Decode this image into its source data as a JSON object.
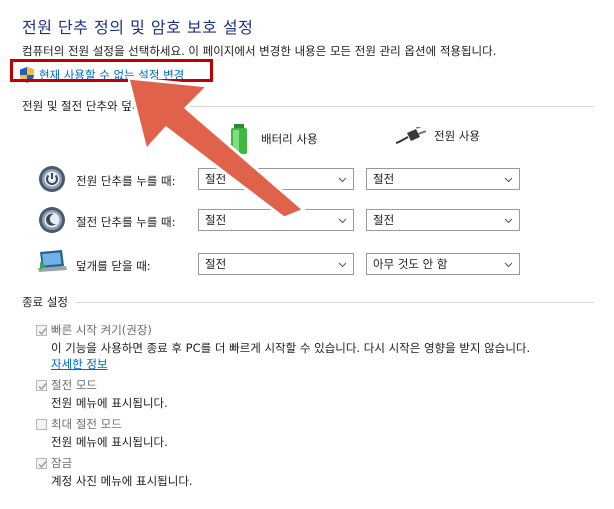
{
  "page": {
    "title": "전원 단추 정의 및 암호 보호 설정",
    "description": "컴퓨터의 전원 설정을 선택하세요. 이 페이지에서 변경한 내용은 모든 전원 관리 옵션에 적용됩니다.",
    "change_link": "현재 사용할 수 없는 설정 변경"
  },
  "power_section": {
    "heading": "전원 및 절전 단추와 덮개 설정",
    "columns": [
      {
        "label": "배터리 사용",
        "icon": "battery-icon"
      },
      {
        "label": "전원 사용",
        "icon": "power-plug-icon"
      }
    ],
    "rows": [
      {
        "label": "전원 단추를 누를 때:",
        "icon": "power-button-icon",
        "battery": "절전",
        "plugged": "절전"
      },
      {
        "label": "절전 단추를 누를 때:",
        "icon": "sleep-button-icon",
        "battery": "절전",
        "plugged": "절전"
      },
      {
        "label": "덮개를 닫을 때:",
        "icon": "laptop-lid-icon",
        "battery": "절전",
        "plugged": "아무 것도 안 함"
      }
    ]
  },
  "shutdown_section": {
    "heading": "종료 설정",
    "items": [
      {
        "label": "빠른 시작 켜기(권장)",
        "checked": true,
        "enabled": false,
        "desc": "이 기능을 사용하면 종료 후 PC를 더 빠르게 시작할 수 있습니다. 다시 시작은 영향을 받지 않습니다.",
        "link": "자세한 정보"
      },
      {
        "label": "절전 모드",
        "checked": true,
        "enabled": false,
        "desc": "전원 메뉴에 표시됩니다."
      },
      {
        "label": "최대 절전 모드",
        "checked": false,
        "enabled": false,
        "desc": "전원 메뉴에 표시됩니다."
      },
      {
        "label": "잠금",
        "checked": true,
        "enabled": false,
        "desc": "계정 사진 메뉴에 표시됩니다."
      }
    ]
  },
  "colors": {
    "title": "#1e3287",
    "link": "#0066cc",
    "highlight_box": "#c00000",
    "arrow": "#e0624a"
  }
}
